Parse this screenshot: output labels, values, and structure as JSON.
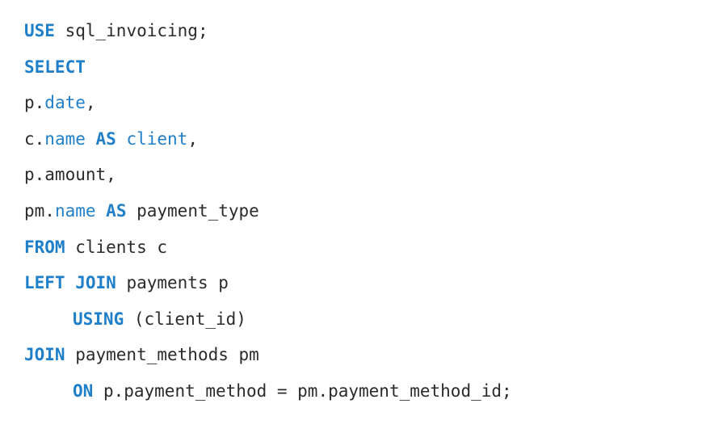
{
  "code": {
    "lines": [
      {
        "parts": [
          {
            "t": "USE",
            "k": "kw"
          },
          {
            "t": " sql_invoicing;",
            "k": "tx"
          }
        ]
      },
      {
        "parts": [
          {
            "t": "SELECT",
            "k": "kw"
          }
        ]
      },
      {
        "parts": [
          {
            "t": "p.",
            "k": "tx"
          },
          {
            "t": "date",
            "k": "bl"
          },
          {
            "t": ",",
            "k": "tx"
          }
        ]
      },
      {
        "parts": [
          {
            "t": "c.",
            "k": "tx"
          },
          {
            "t": "name",
            "k": "bl"
          },
          {
            "t": " ",
            "k": "tx"
          },
          {
            "t": "AS",
            "k": "kw"
          },
          {
            "t": " ",
            "k": "tx"
          },
          {
            "t": "client",
            "k": "bl"
          },
          {
            "t": ",",
            "k": "tx"
          }
        ]
      },
      {
        "parts": [
          {
            "t": "p.amount,",
            "k": "tx"
          }
        ]
      },
      {
        "parts": [
          {
            "t": "pm.",
            "k": "tx"
          },
          {
            "t": "name",
            "k": "bl"
          },
          {
            "t": " ",
            "k": "tx"
          },
          {
            "t": "AS",
            "k": "kw"
          },
          {
            "t": " payment_type",
            "k": "tx"
          }
        ]
      },
      {
        "parts": [
          {
            "t": "FROM",
            "k": "kw"
          },
          {
            "t": " clients c",
            "k": "tx"
          }
        ]
      },
      {
        "parts": [
          {
            "t": "LEFT JOIN",
            "k": "kw"
          },
          {
            "t": " payments p",
            "k": "tx"
          }
        ]
      },
      {
        "indent": true,
        "parts": [
          {
            "t": "USING",
            "k": "kw"
          },
          {
            "t": " (client_id)",
            "k": "tx"
          }
        ]
      },
      {
        "parts": [
          {
            "t": "JOIN",
            "k": "kw"
          },
          {
            "t": " payment_methods pm",
            "k": "tx"
          }
        ]
      },
      {
        "indent": true,
        "parts": [
          {
            "t": "ON",
            "k": "kw"
          },
          {
            "t": " p.payment_method = pm.payment_method_id;",
            "k": "tx"
          }
        ]
      }
    ]
  }
}
